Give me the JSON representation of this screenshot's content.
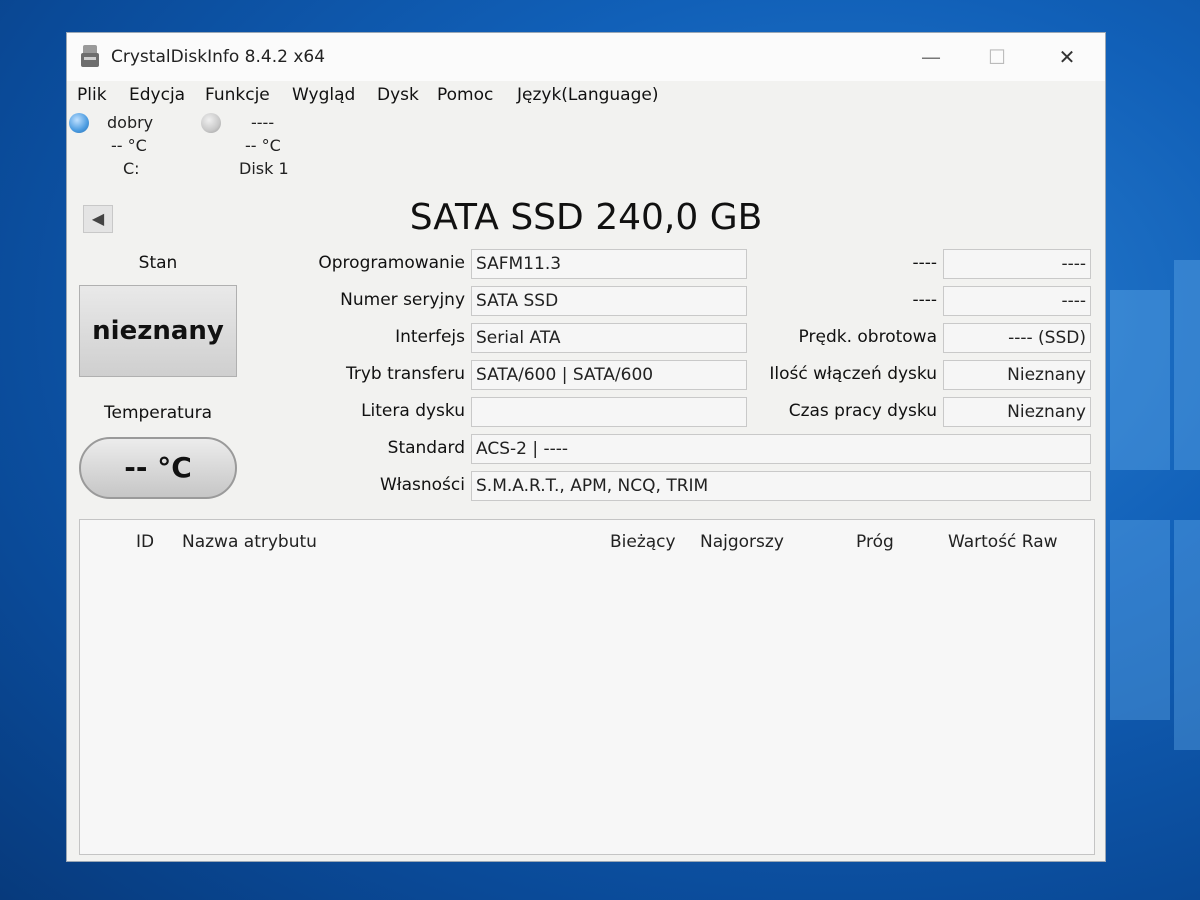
{
  "window": {
    "title": "CrystalDiskInfo 8.4.2 x64",
    "minimize": "—",
    "maximize": "☐",
    "close": "✕"
  },
  "menu": [
    "Plik",
    "Edycja",
    "Funkcje",
    "Wygląd",
    "Dysk",
    "Pomoc",
    "Język(Language)"
  ],
  "disks": [
    {
      "health": "dobry",
      "temp": "-- °C",
      "drive": "C:",
      "led_color": "#4a9be0"
    },
    {
      "health": "----",
      "temp": "-- °C",
      "drive": "Disk 1",
      "led_color": "#c8c8c8"
    }
  ],
  "model": "SATA SSD 240,0 GB",
  "status": {
    "label": "Stan",
    "value": "nieznany"
  },
  "temperature": {
    "label": "Temperatura",
    "value": "-- °C"
  },
  "info_left": [
    {
      "label": "Oprogramowanie",
      "value": "SAFM11.3"
    },
    {
      "label": "Numer seryjny",
      "value": "SATA SSD"
    },
    {
      "label": "Interfejs",
      "value": "Serial ATA"
    },
    {
      "label": "Tryb transferu",
      "value": "SATA/600 | SATA/600"
    },
    {
      "label": "Litera dysku",
      "value": ""
    }
  ],
  "info_right": [
    {
      "label": "----",
      "value": "----"
    },
    {
      "label": "----",
      "value": "----"
    },
    {
      "label": "Prędk. obrotowa",
      "value": "---- (SSD)"
    },
    {
      "label": "Ilość włączeń dysku",
      "value": "Nieznany"
    },
    {
      "label": "Czas pracy dysku",
      "value": "Nieznany"
    }
  ],
  "info_wide": [
    {
      "label": "Standard",
      "value": "ACS-2 | ----"
    },
    {
      "label": "Własności",
      "value": "S.M.A.R.T., APM, NCQ, TRIM"
    }
  ],
  "smart_columns": {
    "id": "ID",
    "name": "Nazwa atrybutu",
    "current": "Bieżący",
    "worst": "Najgorszy",
    "threshold": "Próg",
    "raw": "Wartość Raw"
  }
}
